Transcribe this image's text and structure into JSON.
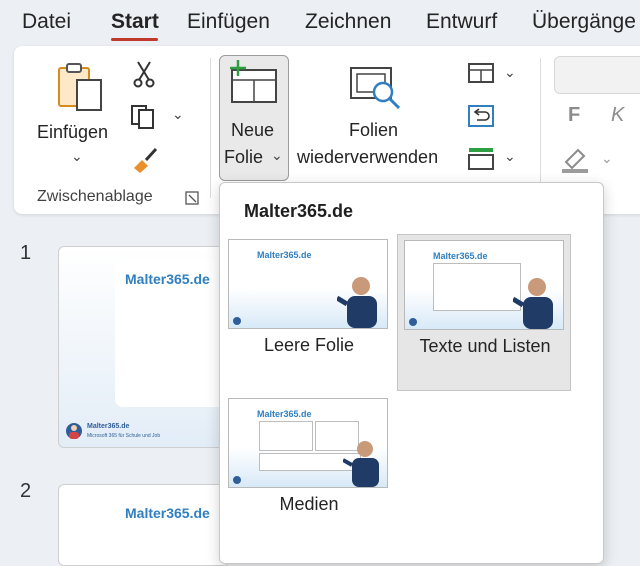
{
  "menu": {
    "tabs": [
      "Datei",
      "Start",
      "Einfügen",
      "Zeichnen",
      "Entwurf",
      "Übergänge"
    ]
  },
  "ribbon": {
    "paste_label": "Einfügen",
    "clipboard_group": "Zwischenablage",
    "new_slide_line1": "Neue",
    "new_slide_line2": "Folie",
    "reuse_line1": "Folien",
    "reuse_line2": "wiederverwenden",
    "bold_glyph": "F",
    "italic_glyph": "K"
  },
  "slides": [
    {
      "number": "1",
      "title": "Malter365.de",
      "footer_title": "Malter365.de",
      "footer_sub": "Microsoft 365 für Schule und Job"
    },
    {
      "number": "2",
      "title": "Malter365.de"
    }
  ],
  "dropdown": {
    "title": "Malter365.de",
    "layouts": [
      {
        "label": "Leere Folie",
        "thumb_title": "Malter365.de"
      },
      {
        "label": "Texte und Listen",
        "thumb_title": "Malter365.de"
      },
      {
        "label": "Medien",
        "thumb_title": "Malter365.de"
      }
    ]
  },
  "colors": {
    "accent": "#c0392b",
    "brand_blue": "#2f7fc1",
    "orange": "#e8912b"
  }
}
